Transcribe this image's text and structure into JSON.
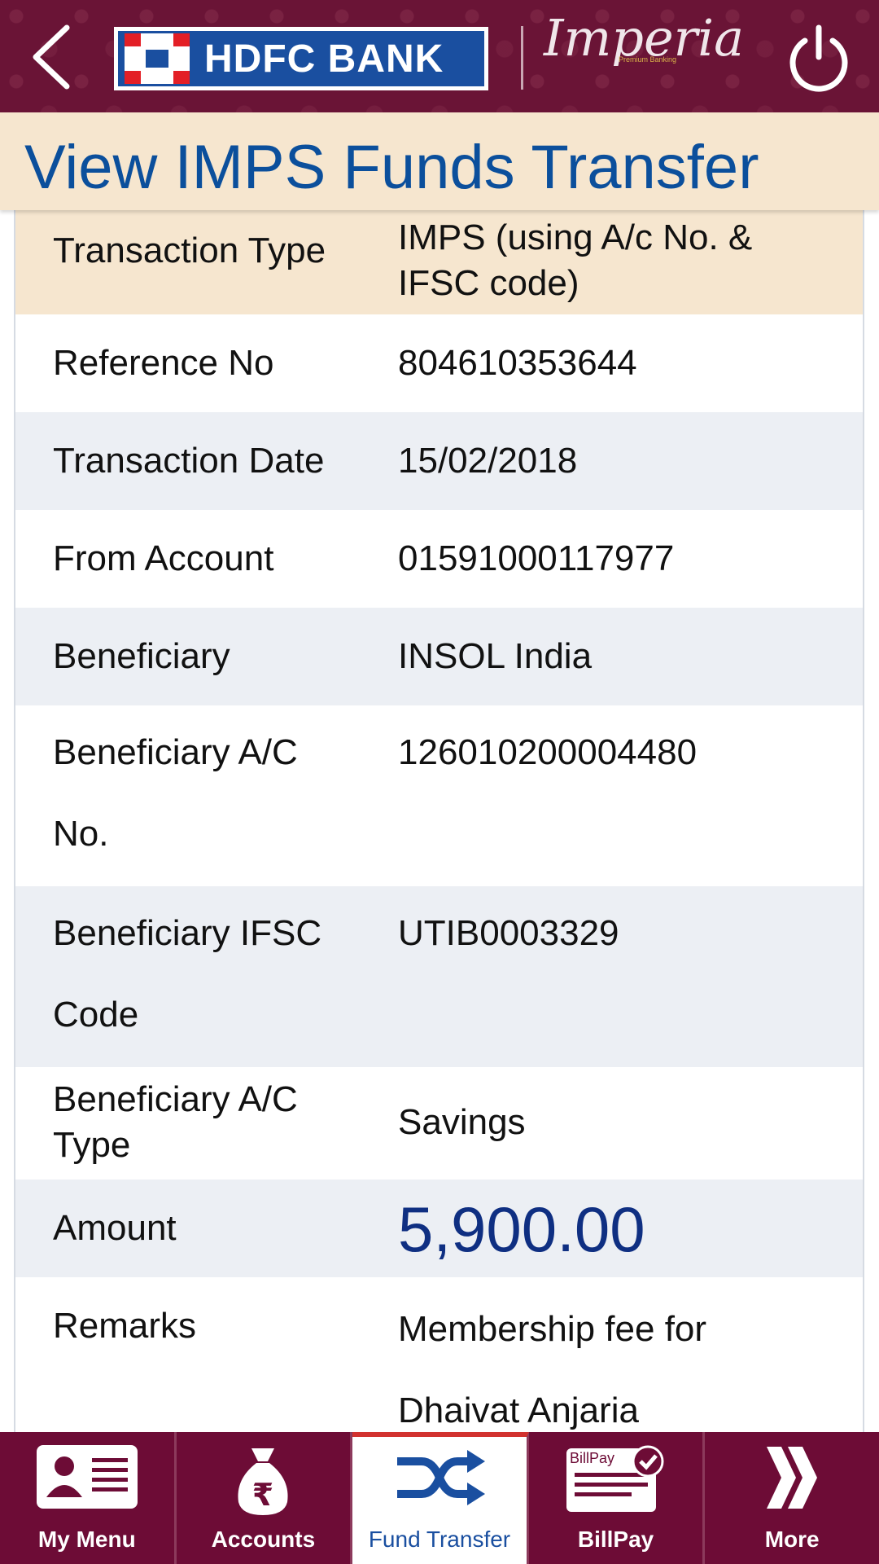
{
  "header": {
    "brand": "HDFC BANK",
    "sub_brand": "Imperia",
    "sub_brand_tagline": "Premium Banking"
  },
  "page": {
    "title": "View IMPS Funds Transfer"
  },
  "details": {
    "transaction_type": {
      "label": "Transaction Type",
      "value": "IMPS (using A/c No. & IFSC code)"
    },
    "reference_no": {
      "label": "Reference No",
      "value": "804610353644"
    },
    "transaction_date": {
      "label": "Transaction Date",
      "value": "15/02/2018"
    },
    "from_account": {
      "label": "From Account",
      "value": "01591000117977"
    },
    "beneficiary": {
      "label": "Beneficiary",
      "value": "INSOL India"
    },
    "beneficiary_ac_no": {
      "label": "Beneficiary A/C No.",
      "value": "126010200004480"
    },
    "beneficiary_ifsc": {
      "label": "Beneficiary IFSC Code",
      "value": "UTIB0003329"
    },
    "beneficiary_ac_type": {
      "label": "Beneficiary A/C Type",
      "value": "Savings"
    },
    "amount": {
      "label": "Amount",
      "value": "5,900.00"
    },
    "remarks": {
      "label": "Remarks",
      "value": "Membership fee for Dhaivat Anjaria"
    }
  },
  "nav": {
    "my_menu": "My Menu",
    "accounts": "Accounts",
    "fund_transfer": "Fund Transfer",
    "billpay": "BillPay",
    "billpay_icon_text": "BillPay",
    "more": "More"
  },
  "colors": {
    "header_bg": "#6a1436",
    "title_bg": "#f6e6cf",
    "title_text": "#0b4f9c",
    "row_alt_bg": "#eceff4",
    "amount_text": "#0f2f82",
    "nav_bg": "#6d0c36",
    "active_tab_accent": "#d2322f"
  }
}
